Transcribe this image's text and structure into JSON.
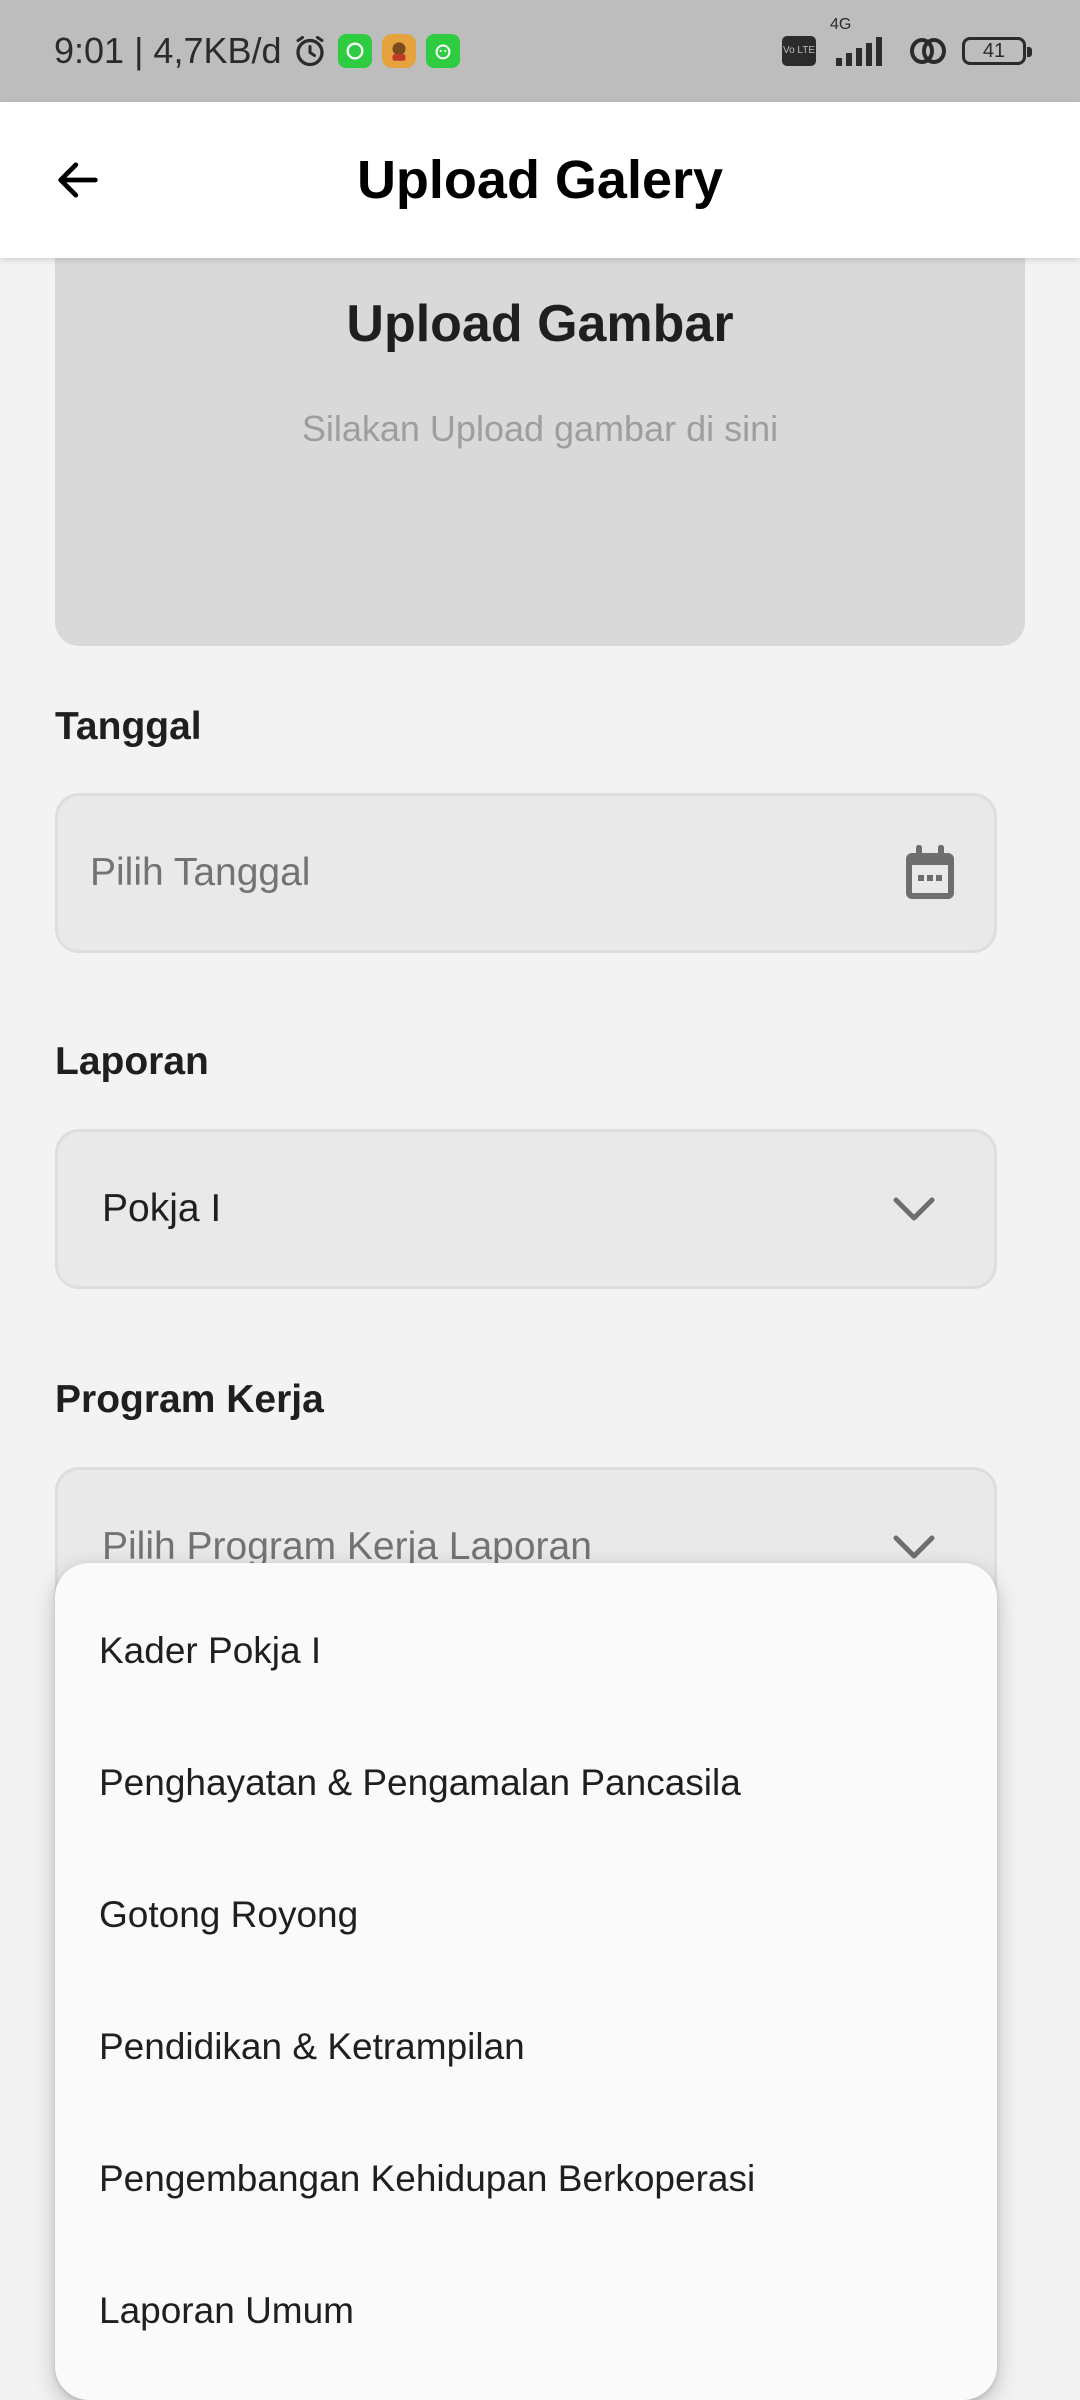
{
  "status_bar": {
    "time_and_speed": "9:01 | 4,7KB/d",
    "volte": "Vo LTE",
    "network": "4G",
    "battery": "41"
  },
  "app_bar": {
    "title": "Upload Galery"
  },
  "upload": {
    "title": "Upload Gambar",
    "subtitle": "Silakan Upload gambar di sini"
  },
  "form": {
    "tanggal": {
      "label": "Tanggal",
      "placeholder": "Pilih Tanggal"
    },
    "laporan": {
      "label": "Laporan",
      "value": "Pokja I"
    },
    "program_kerja": {
      "label": "Program Kerja",
      "placeholder": "Pilih Program Kerja Laporan"
    }
  },
  "dropdown": {
    "items": [
      "Kader Pokja I",
      "Penghayatan & Pengamalan Pancasila",
      "Gotong Royong",
      "Pendidikan & Ketrampilan",
      "Pengembangan Kehidupan Berkoperasi",
      "Laporan Umum"
    ]
  },
  "colors": {
    "app_bar_bg": "#ffffff",
    "status_bar_bg": "#bdbdbd",
    "page_bg": "#f3f3f3",
    "upload_card_bg": "#d9d9d9",
    "field_bg": "#e9e9e9",
    "menu_bg": "#fafafa"
  }
}
